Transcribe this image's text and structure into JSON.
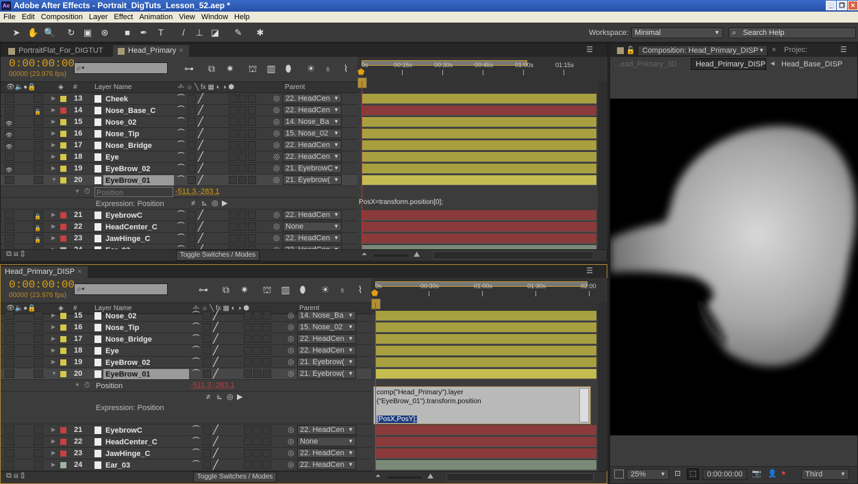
{
  "app": {
    "title": "Adobe After Effects - Portrait_DigTuts_Lesson_52.aep *",
    "logo": "Ae"
  },
  "menu": [
    "File",
    "Edit",
    "Composition",
    "Layer",
    "Effect",
    "Animation",
    "View",
    "Window",
    "Help"
  ],
  "toolbar": {
    "workspace_label": "Workspace:",
    "workspace_value": "Minimal",
    "search_placeholder": "Search Help"
  },
  "upper": {
    "tabs": [
      "PortraitFlat_For_DIGTUT",
      "Head_Primary"
    ],
    "time": "0:00:00:00",
    "fps": "00000 (23.976 fps)",
    "columns": {
      "num": "#",
      "name": "Layer Name",
      "parent": "Parent"
    },
    "ruler": [
      "0s",
      "00:15s",
      "00:30s",
      "00:45s",
      "01:00s",
      "01:15s"
    ],
    "layers": [
      {
        "num": "13",
        "name": "Cheek",
        "color": "#d4c84a",
        "parent": "22. HeadCen",
        "eye": false,
        "lock": false,
        "bar": "#a8a040"
      },
      {
        "num": "14",
        "name": "Nose_Base_C",
        "color": "#c84040",
        "parent": "22. HeadCen",
        "eye": false,
        "lock": true,
        "bar": "#8a3a3a"
      },
      {
        "num": "15",
        "name": "Nose_02",
        "color": "#d4c84a",
        "parent": "14. Nose_Ba",
        "eye": true,
        "lock": false,
        "bar": "#a8a040"
      },
      {
        "num": "16",
        "name": "Nose_Tip",
        "color": "#d4c84a",
        "parent": "15. Nose_02",
        "eye": true,
        "lock": false,
        "bar": "#a8a040"
      },
      {
        "num": "17",
        "name": "Nose_Bridge",
        "color": "#d4c84a",
        "parent": "22. HeadCen",
        "eye": true,
        "lock": false,
        "bar": "#a8a040"
      },
      {
        "num": "18",
        "name": "Eye",
        "color": "#d4c84a",
        "parent": "22. HeadCen",
        "eye": false,
        "lock": false,
        "bar": "#a8a040"
      },
      {
        "num": "19",
        "name": "EyeBrow_02",
        "color": "#d4c84a",
        "parent": "21. EyebrowC",
        "eye": true,
        "lock": false,
        "bar": "#a8a040"
      },
      {
        "num": "20",
        "name": "EyeBrow_01",
        "color": "#d4c84a",
        "parent": "21. Eyebrow(",
        "eye": false,
        "lock": false,
        "bar": "#c4bc50",
        "selected": true,
        "open": true
      },
      {
        "num": "21",
        "name": "EyebrowC",
        "color": "#c84040",
        "parent": "22. HeadCen",
        "eye": false,
        "lock": true,
        "bar": "#8a3a3a"
      },
      {
        "num": "22",
        "name": "HeadCenter_C",
        "color": "#c84040",
        "parent": "None",
        "eye": false,
        "lock": true,
        "bar": "#8a3a3a"
      },
      {
        "num": "23",
        "name": "JawHinge_C",
        "color": "#c84040",
        "parent": "22. HeadCen",
        "eye": false,
        "lock": true,
        "bar": "#8a3a3a"
      },
      {
        "num": "24",
        "name": "Ear_03",
        "color": "#a0b4a0",
        "parent": "22. HeadCen",
        "eye": false,
        "lock": false,
        "bar": "#7a8a78"
      }
    ],
    "property": {
      "name": "Position",
      "value": "-511.3,-283.1",
      "expression_label": "Expression: Position",
      "expression": "PosX=transform.position[0];"
    },
    "toggle": "Toggle Switches / Modes"
  },
  "lower": {
    "tab": "Head_Primary_DISP",
    "time": "0:00:00:00",
    "fps": "00000 (23.976 fps)",
    "columns": {
      "num": "#",
      "name": "Layer Name",
      "parent": "Parent"
    },
    "ruler": [
      "0s",
      "00:30s",
      "01:00s",
      "01:30s",
      "02:00"
    ],
    "layers": [
      {
        "num": "15",
        "name": "Nose_02",
        "color": "#d4c84a",
        "parent": "14. Nose_Ba",
        "bar": "#a8a040"
      },
      {
        "num": "16",
        "name": "Nose_Tip",
        "color": "#d4c84a",
        "parent": "15. Nose_02",
        "bar": "#a8a040"
      },
      {
        "num": "17",
        "name": "Nose_Bridge",
        "color": "#d4c84a",
        "parent": "22. HeadCen",
        "bar": "#a8a040"
      },
      {
        "num": "18",
        "name": "Eye",
        "color": "#d4c84a",
        "parent": "22. HeadCen",
        "bar": "#a8a040"
      },
      {
        "num": "19",
        "name": "EyeBrow_02",
        "color": "#d4c84a",
        "parent": "21. Eyebrow(",
        "bar": "#a8a040"
      },
      {
        "num": "20",
        "name": "EyeBrow_01",
        "color": "#d4c84a",
        "parent": "21. Eyebrow(",
        "bar": "#c4bc50",
        "selected": true,
        "open": true
      },
      {
        "num": "21",
        "name": "EyebrowC",
        "color": "#c84040",
        "parent": "22. HeadCen",
        "bar": "#8a3a3a"
      },
      {
        "num": "22",
        "name": "HeadCenter_C",
        "color": "#c84040",
        "parent": "None",
        "bar": "#8a3a3a"
      },
      {
        "num": "23",
        "name": "JawHinge_C",
        "color": "#c84040",
        "parent": "22. HeadCen",
        "bar": "#8a3a3a"
      },
      {
        "num": "24",
        "name": "Ear_03",
        "color": "#a0b4a0",
        "parent": "22. HeadCen",
        "bar": "#7a8a78"
      }
    ],
    "property": {
      "name": "Position",
      "value": "-511.3,-283.1",
      "expression_label": "Expression: Position",
      "expression_lines": [
        "comp(\"Head_Primary\").layer",
        "(\"EyeBrow_01\").transform.position",
        "",
        "[PosX,PosY];"
      ]
    },
    "toggle": "Toggle Switches / Modes"
  },
  "viewer": {
    "tab": "Composition: Head_Primary_DISP",
    "project_tab": "Projec:",
    "breadcrumbs": [
      "...ead_Primary_3D",
      "Head_Primary_DISP",
      "Head_Base_DISP"
    ],
    "zoom": "25%",
    "time": "0:00:00:00",
    "resolution": "Third"
  }
}
